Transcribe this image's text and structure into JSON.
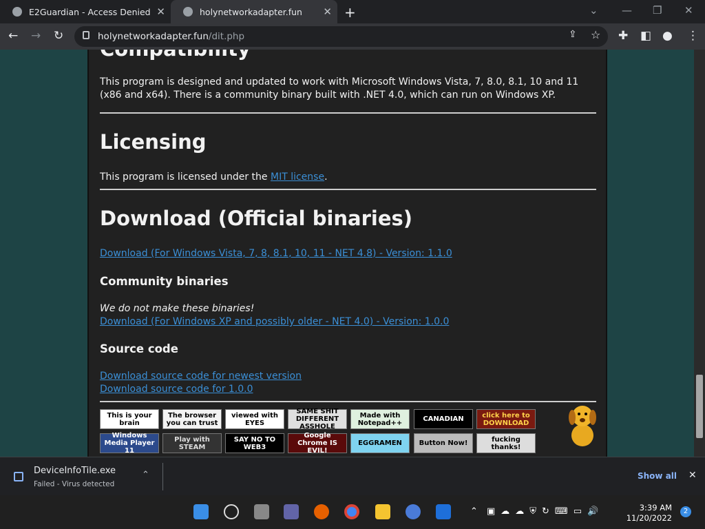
{
  "tabs": [
    "E2Guardian - Access Denied",
    "holynetworkadapter.fun"
  ],
  "url": {
    "host": "holynetworkadapter.fun",
    "path": "/dit.php"
  },
  "page": {
    "h_compat": "Compatibility",
    "compat_text": "This program is designed and updated to work with Microsoft Windows Vista, 7, 8.0, 8.1, 10 and 11 (x86 and x64). There is a community binary built with .NET 4.0, which can run on Windows XP.",
    "h_lic": "Licensing",
    "lic_pre": "This program is licensed under the ",
    "lic_link": "MIT license",
    "lic_post": ".",
    "h_dl": "Download (Official binaries)",
    "dl_link": "Download (For Windows Vista, 7, 8, 8.1, 10, 11 - NET 4.8) - Version: 1.1.0",
    "h_comm": "Community binaries",
    "comm_note": "We do not make these binaries!",
    "comm_link": "Download (For Windows XP and possibly older - NET 4.0) - Version: 1.0.0",
    "h_src": "Source code",
    "src_link1": "Download source code for newest version",
    "src_link2": "Download source code for 1.0.0"
  },
  "badges": [
    "This is your brain",
    "The browser you can trust",
    "viewed with EYES",
    "SAME SHIT DIFFERENT ASSHOLE",
    "Made with Notepad++",
    "CANADIAN",
    "click here to DOWNLOAD",
    "Windows Media Player 11",
    "Play with STEAM",
    "SAY NO TO WEB3",
    "Google Chrome IS EVIL!",
    "EGGRAMEN",
    "Button Now!",
    "fucking thanks!"
  ],
  "download": {
    "name": "DeviceInfoTile.exe",
    "status": "Failed - Virus detected",
    "show_all": "Show all"
  },
  "clock": {
    "time": "3:39 AM",
    "date": "11/20/2022",
    "badge": "2"
  }
}
